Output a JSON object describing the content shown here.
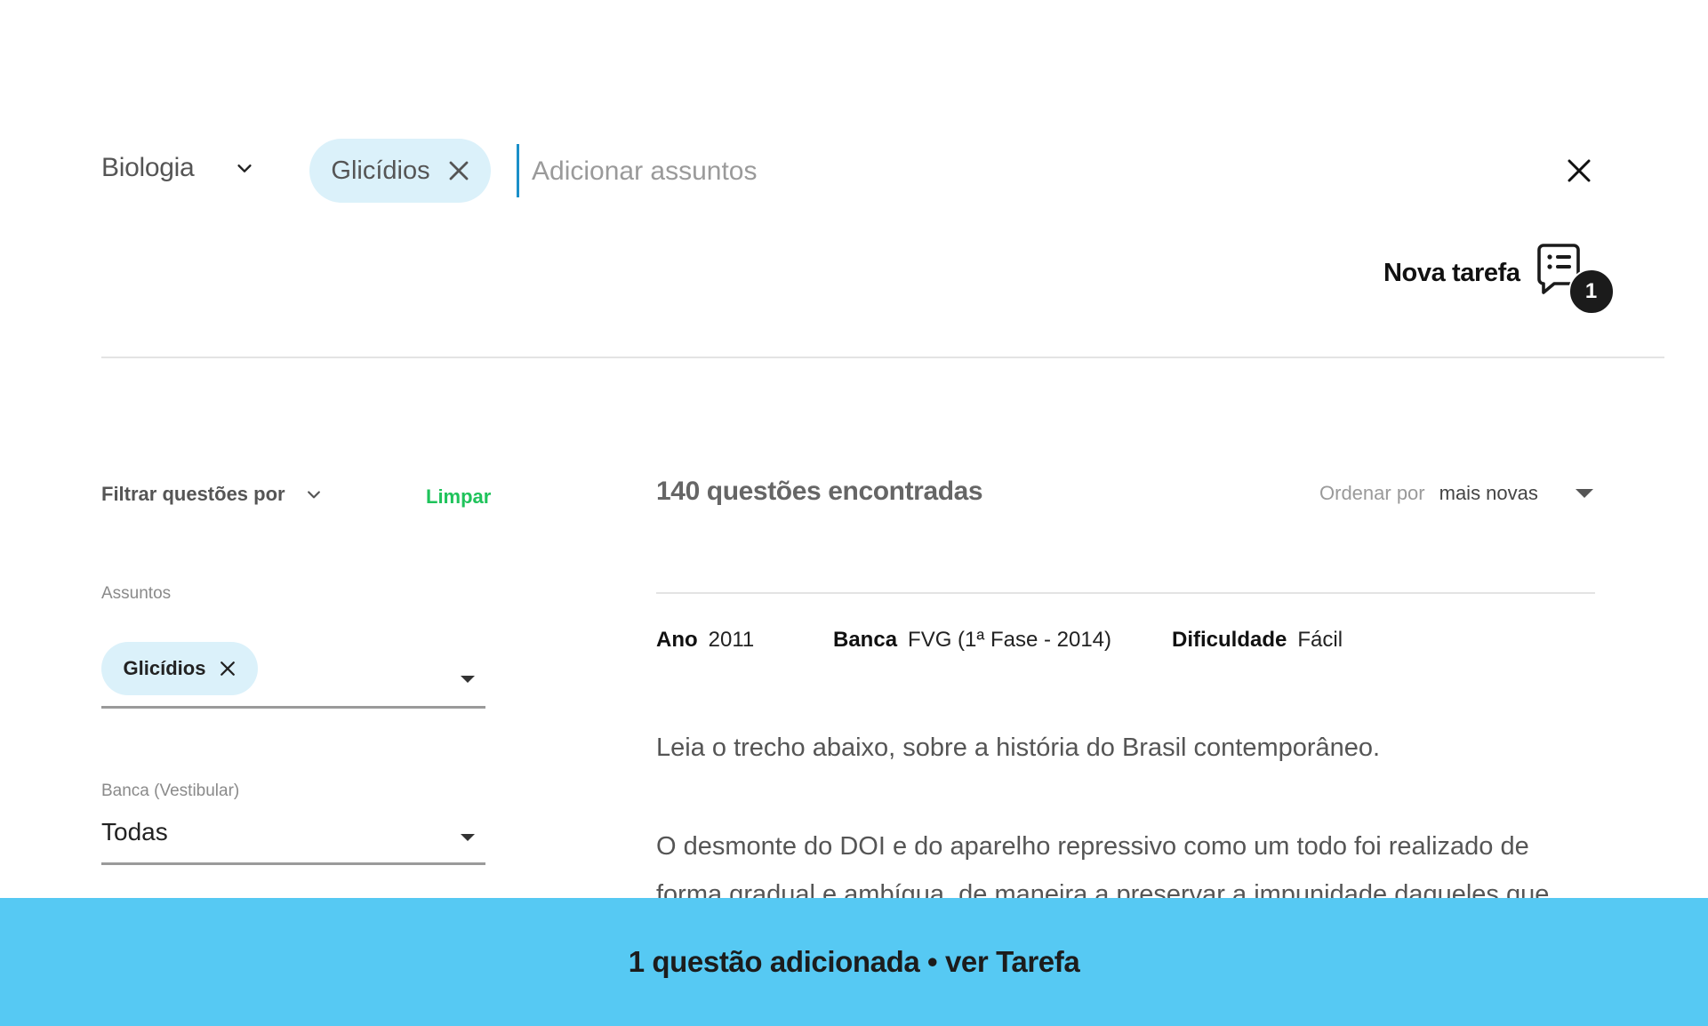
{
  "search": {
    "subject": "Biologia",
    "chips": [
      {
        "label": "Glicídios"
      }
    ],
    "placeholder": "Adicionar assuntos",
    "value": ""
  },
  "task": {
    "label": "Nova tarefa",
    "count": "1"
  },
  "filters": {
    "title": "Filtrar questões por",
    "clear_label": "Limpar",
    "assuntos": {
      "label": "Assuntos",
      "chips": [
        {
          "label": "Glicídios"
        }
      ]
    },
    "banca": {
      "label": "Banca (Vestibular)",
      "value": "Todas"
    }
  },
  "results": {
    "count_text": "140 questões encontradas",
    "sort": {
      "label": "Ordenar por",
      "value": "mais novas"
    }
  },
  "question": {
    "meta": {
      "ano_label": "Ano",
      "ano": "2011",
      "banca_label": "Banca",
      "banca": "FVG (1ª Fase - 2014)",
      "dificuldade_label": "Dificuldade",
      "dificuldade": "Fácil"
    },
    "intro": "Leia o trecho abaixo, sobre a história do Brasil contemporâneo.",
    "paragraph": "O desmonte do DOI e do aparelho repressivo como um todo foi realizado de forma gradual e ambígua, de maneira a preservar a impunidade daqueles que"
  },
  "toast": {
    "text": "1 questão adicionada • ver Tarefa"
  },
  "colors": {
    "chip_bg": "#dbf1fa",
    "accent_green": "#1fc35b",
    "toast_bg": "#56c9f3",
    "caret": "#1a8fc9"
  }
}
